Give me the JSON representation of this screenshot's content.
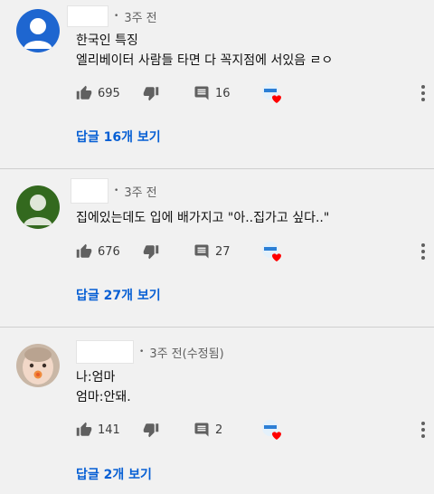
{
  "comments": [
    {
      "time": "3주 전",
      "lines": [
        "한국인 특징",
        "엘리베이터 사람들 타면 다 꼭지점에 서있음 ㄹㅇ"
      ],
      "likes": "695",
      "replies_count": "16",
      "view_replies": "답글 16개 보기",
      "avatar": "default-blue"
    },
    {
      "time": "3주 전",
      "lines": [
        "집에있는데도 입에 배가지고 \"아..집가고 싶다..\""
      ],
      "likes": "676",
      "replies_count": "27",
      "view_replies": "답글 27개 보기",
      "avatar": "default-green"
    },
    {
      "time": "3주 전(수정됨)",
      "lines": [
        "나:엄마",
        "엄마:안돼."
      ],
      "likes": "141",
      "replies_count": "2",
      "view_replies": "답글 2개 보기",
      "avatar": "baby-photo"
    }
  ],
  "colors": {
    "background": "#f1f1f1",
    "link": "#065fd4",
    "heart": "#ff0000",
    "avatar_blue": "#1e66d0",
    "avatar_green": "#33691e"
  },
  "icons": [
    "thumbs-up-icon",
    "thumbs-down-icon",
    "reply-icon",
    "creator-heart-icon",
    "more-vert-icon"
  ]
}
